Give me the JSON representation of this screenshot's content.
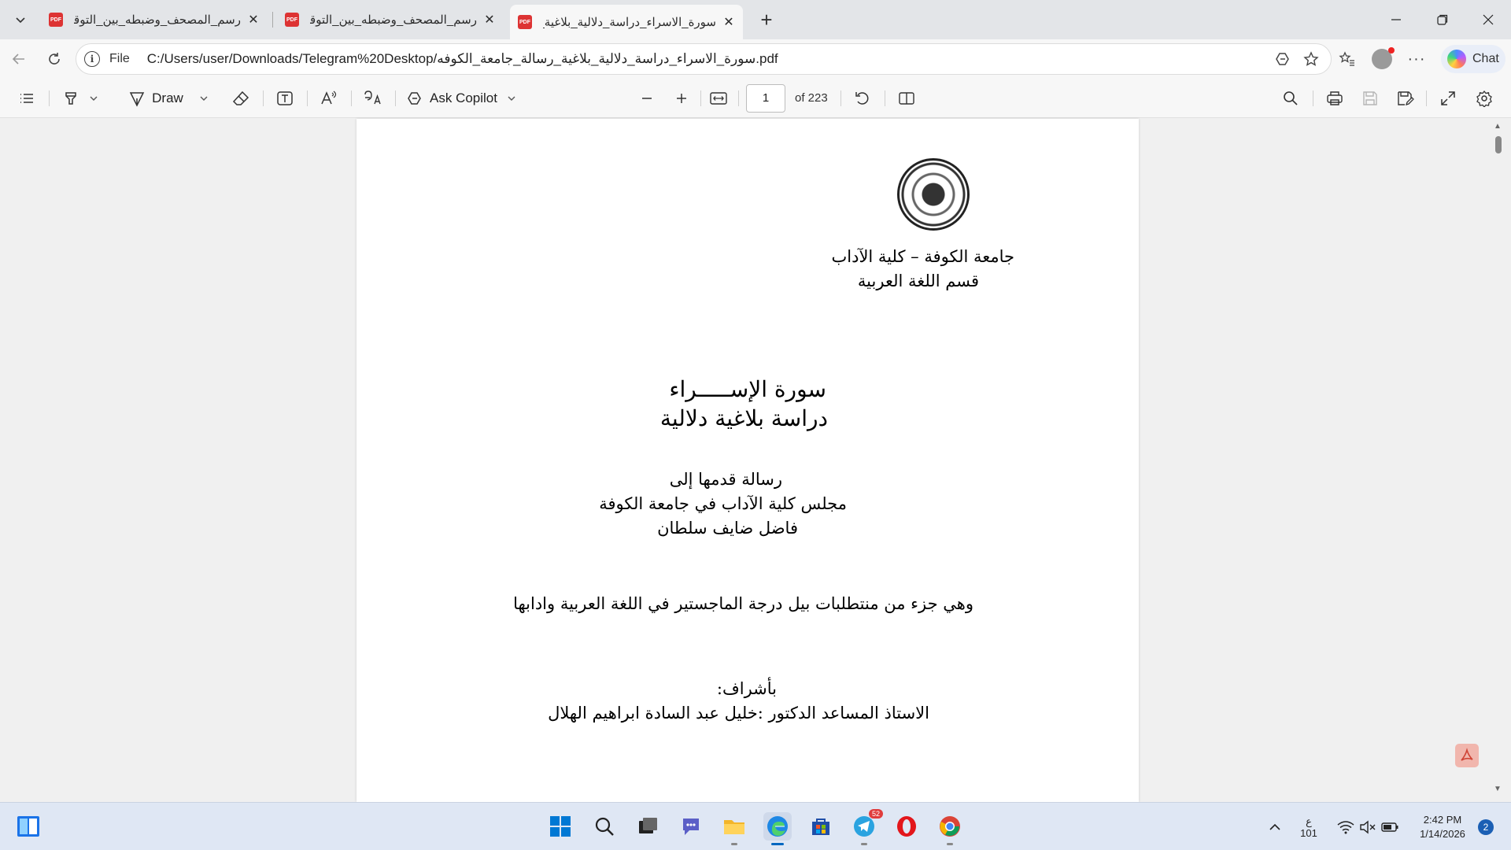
{
  "tabs": [
    {
      "title": "رسم_المصحف_وضبطه_بين_التوقيف",
      "active": false
    },
    {
      "title": "رسم_المصحف_وضبطه_بين_التوقيف",
      "active": false
    },
    {
      "title": "سورة_الاسراء_دراسة_دلالية_بلاغية_رسالة",
      "active": true
    }
  ],
  "pdf_tab_icon": "PDF",
  "address": {
    "scheme_label": "File",
    "url": "C:/Users/user/Downloads/Telegram%20Desktop/سورة_الاسراء_دراسة_دلالية_بلاغية_رسالة_جامعة_الكوفه.pdf"
  },
  "chat_label": "Chat",
  "toolbar": {
    "draw_label": "Draw",
    "copilot_label": "Ask Copilot",
    "page_current": "1",
    "page_total": "of 223"
  },
  "page": {
    "university": "جامعة الكوفة – كلية الآداب",
    "department": "قسم اللغة العربية",
    "title_line1": "سورة الإســـــراء",
    "title_line2": "دراسة بلاغية دلالية",
    "submitted_to": "رسالة قدمها إلى",
    "council": "مجلس كلية الآداب في جامعة الكوفة",
    "author": "فاضل ضايف سلطان",
    "degree": "وهي جزء من منتطلبات بيل درجة الماجستير في اللغة العربية وادابها",
    "supervision_label": "بأشراف:",
    "supervisor": "الاستاذ المساعد الدكتور :خليل عبد السادة ابراهيم الهلال"
  },
  "taskbar": {
    "telegram_badge": "52",
    "tray_lang_top": "ع",
    "tray_lang_bottom": "101",
    "time": "2:42 PM",
    "date": "1/14/2026",
    "notifications": "2"
  }
}
